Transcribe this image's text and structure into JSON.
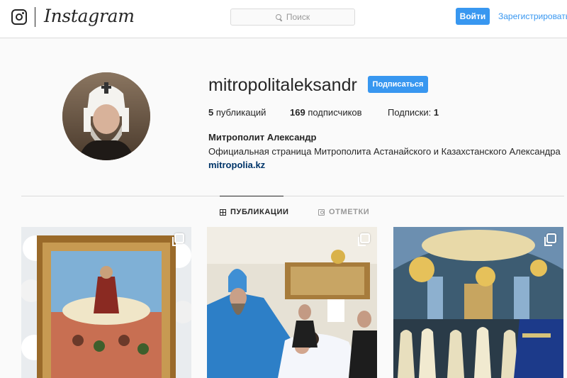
{
  "header": {
    "brand": "Instagram",
    "search_placeholder": "Поиск",
    "login_label": "Войти",
    "register_label": "Зарегистрироваться"
  },
  "profile": {
    "username": "mitropolitaleksandr",
    "follow_label": "Подписаться",
    "stats": {
      "posts_count": "5",
      "posts_label": "публикаций",
      "followers_count": "169",
      "followers_label": "подписчиков",
      "following_label": "Подписки:",
      "following_count": "1"
    },
    "full_name": "Митрополит Александр",
    "bio": "Официальная страница Митрополита Астанайского и Казахстанского Александра",
    "website": "mitropolia.kz"
  },
  "tabs": [
    {
      "label": "ПУБЛИКАЦИИ",
      "icon": "grid-icon",
      "active": true
    },
    {
      "label": "ОТМЕТКИ",
      "icon": "tag-icon",
      "active": false
    }
  ],
  "posts": [
    {
      "subject": "icon-with-flowers",
      "multi": true
    },
    {
      "subject": "clergy-ceremony",
      "multi": true
    },
    {
      "subject": "cathedral-interior",
      "multi": true
    }
  ],
  "colors": {
    "accent": "#3897f0",
    "link": "#003569",
    "text": "#262626",
    "muted": "#999999",
    "border": "#dbdbdb",
    "background": "#fafafa"
  }
}
